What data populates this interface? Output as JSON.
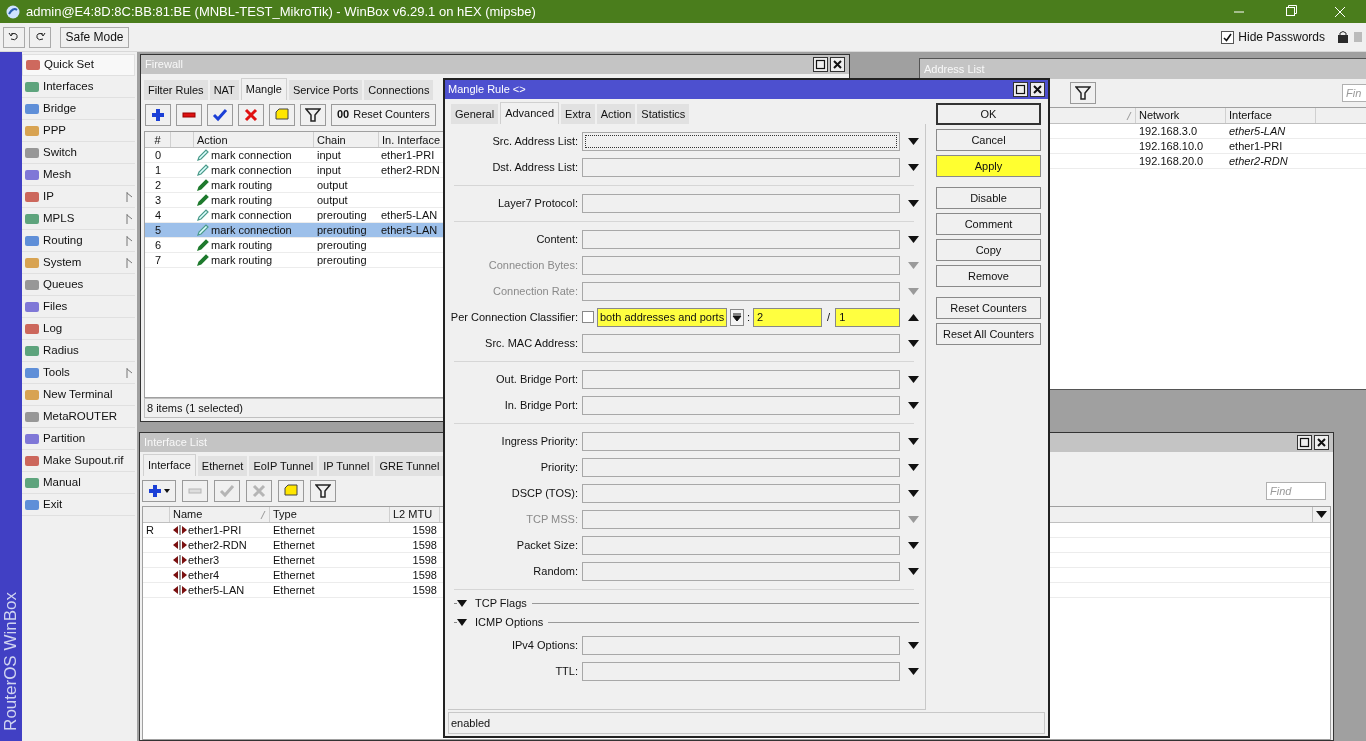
{
  "window": {
    "title": "admin@E4:8D:8C:BB:81:BE (MNBL-TEST_MikroTik) - WinBox v6.29.1 on hEX (mipsbe)"
  },
  "toolbar": {
    "safe_mode": "Safe Mode",
    "hide_passwords": {
      "label": "Hide Passwords",
      "checked": true
    }
  },
  "brand": "RouterOS WinBox",
  "sidebar": {
    "items": [
      {
        "label": "Quick Set",
        "submenu": false,
        "selected": true
      },
      {
        "label": "Interfaces",
        "submenu": false,
        "selected": false
      },
      {
        "label": "Bridge",
        "submenu": false,
        "selected": false
      },
      {
        "label": "PPP",
        "submenu": false,
        "selected": false
      },
      {
        "label": "Switch",
        "submenu": false,
        "selected": false
      },
      {
        "label": "Mesh",
        "submenu": false,
        "selected": false
      },
      {
        "label": "IP",
        "submenu": true,
        "selected": false
      },
      {
        "label": "MPLS",
        "submenu": true,
        "selected": false
      },
      {
        "label": "Routing",
        "submenu": true,
        "selected": false
      },
      {
        "label": "System",
        "submenu": true,
        "selected": false
      },
      {
        "label": "Queues",
        "submenu": false,
        "selected": false
      },
      {
        "label": "Files",
        "submenu": false,
        "selected": false
      },
      {
        "label": "Log",
        "submenu": false,
        "selected": false
      },
      {
        "label": "Radius",
        "submenu": false,
        "selected": false
      },
      {
        "label": "Tools",
        "submenu": true,
        "selected": false
      },
      {
        "label": "New Terminal",
        "submenu": false,
        "selected": false
      },
      {
        "label": "MetaROUTER",
        "submenu": false,
        "selected": false
      },
      {
        "label": "Partition",
        "submenu": false,
        "selected": false
      },
      {
        "label": "Make Supout.rif",
        "submenu": false,
        "selected": false
      },
      {
        "label": "Manual",
        "submenu": false,
        "selected": false
      },
      {
        "label": "Exit",
        "submenu": false,
        "selected": false
      }
    ]
  },
  "firewall": {
    "title": "Firewall",
    "tabs": [
      {
        "label": "Filter Rules",
        "selected": false
      },
      {
        "label": "NAT",
        "selected": false
      },
      {
        "label": "Mangle",
        "selected": true
      },
      {
        "label": "Service Ports",
        "selected": false
      },
      {
        "label": "Connections",
        "selected": false
      }
    ],
    "toolbar": [
      {
        "kind": "add",
        "disabled": false
      },
      {
        "kind": "remove",
        "disabled": false
      },
      {
        "kind": "enable",
        "disabled": false
      },
      {
        "kind": "disable",
        "disabled": false
      },
      {
        "kind": "comment",
        "disabled": false
      },
      {
        "kind": "filter",
        "disabled": false
      }
    ],
    "reset_button": {
      "prefix": "00",
      "label": "Reset Counters"
    },
    "columns": [
      "#",
      "Action",
      "Chain",
      "In. Interface"
    ],
    "rows": [
      {
        "num": "0",
        "kind": "connection",
        "action": "mark connection",
        "chain": "input",
        "in_interface": "ether1-PRI",
        "selected": false
      },
      {
        "num": "1",
        "kind": "connection",
        "action": "mark connection",
        "chain": "input",
        "in_interface": "ether2-RDN",
        "selected": false
      },
      {
        "num": "2",
        "kind": "routing",
        "action": "mark routing",
        "chain": "output",
        "selected": false
      },
      {
        "num": "3",
        "kind": "routing",
        "action": "mark routing",
        "chain": "output",
        "selected": false
      },
      {
        "num": "4",
        "kind": "connection",
        "action": "mark connection",
        "chain": "prerouting",
        "in_interface": "ether5-LAN",
        "selected": false
      },
      {
        "num": "5",
        "kind": "connection",
        "action": "mark connection",
        "chain": "prerouting",
        "in_interface": "ether5-LAN",
        "selected": true
      },
      {
        "num": "6",
        "kind": "routing",
        "action": "mark routing",
        "chain": "prerouting",
        "selected": false
      },
      {
        "num": "7",
        "kind": "routing",
        "action": "mark routing",
        "chain": "prerouting",
        "selected": false
      }
    ],
    "status": "8 items (1 selected)"
  },
  "address_list": {
    "title": "Address List",
    "find_placeholder": "Fin",
    "columns": [
      {
        "sorted": true
      },
      {
        "label": "Network",
        "sorted": false
      },
      {
        "label": "Interface",
        "sorted": false
      }
    ],
    "rows": [
      {
        "network": "192.168.3.0",
        "interface": "ether5-LAN",
        "dynamic": true
      },
      {
        "network": "192.168.10.0",
        "interface": "ether1-PRI",
        "dynamic": false
      },
      {
        "network": "192.168.20.0",
        "interface": "ether2-RDN",
        "dynamic": true
      }
    ]
  },
  "interface_list": {
    "title": "Interface List",
    "find_placeholder": "Find",
    "tabs": [
      {
        "label": "Interface",
        "selected": true
      },
      {
        "label": "Ethernet",
        "selected": false
      },
      {
        "label": "EoIP Tunnel",
        "selected": false
      },
      {
        "label": "IP Tunnel",
        "selected": false
      },
      {
        "label": "GRE Tunnel",
        "selected": false
      }
    ],
    "toolbar": [
      {
        "kind": "add-menu",
        "disabled": false
      },
      {
        "kind": "remove",
        "disabled": true
      },
      {
        "kind": "enable",
        "disabled": true
      },
      {
        "kind": "disable",
        "disabled": true
      },
      {
        "kind": "comment",
        "disabled": false
      },
      {
        "kind": "filter",
        "disabled": false
      }
    ],
    "columns": [
      {
        "label": "Name",
        "sorted": true
      },
      {
        "label": "Type",
        "sorted": false
      },
      {
        "label": "L2 MTU",
        "sorted": false
      }
    ],
    "rows": [
      {
        "flag": "R",
        "name": "ether1-PRI",
        "type": "Ethernet",
        "l2mtu": "1598"
      },
      {
        "name": "ether2-RDN",
        "type": "Ethernet",
        "l2mtu": "1598"
      },
      {
        "name": "ether3",
        "type": "Ethernet",
        "l2mtu": "1598"
      },
      {
        "name": "ether4",
        "type": "Ethernet",
        "l2mtu": "1598"
      },
      {
        "name": "ether5-LAN",
        "type": "Ethernet",
        "l2mtu": "1598"
      }
    ]
  },
  "mangle_rule": {
    "title": "Mangle Rule <>",
    "tabs": [
      {
        "label": "General",
        "selected": false
      },
      {
        "label": "Advanced",
        "selected": true
      },
      {
        "label": "Extra",
        "selected": false
      },
      {
        "label": "Action",
        "selected": false
      },
      {
        "label": "Statistics",
        "selected": false
      }
    ],
    "form": [
      {
        "kind": "field",
        "label": "Src. Address List:",
        "disabled": false,
        "expanded": false,
        "focused": true
      },
      {
        "kind": "field",
        "label": "Dst. Address List:",
        "disabled": false,
        "expanded": false,
        "focused": false
      },
      {
        "kind": "separator"
      },
      {
        "kind": "field",
        "label": "Layer7 Protocol:",
        "disabled": false,
        "expanded": false,
        "focused": false
      },
      {
        "kind": "separator"
      },
      {
        "kind": "field",
        "label": "Content:",
        "disabled": false,
        "expanded": false,
        "focused": false
      },
      {
        "kind": "field",
        "label": "Connection Bytes:",
        "disabled": true,
        "expanded": false,
        "focused": false
      },
      {
        "kind": "field",
        "label": "Connection Rate:",
        "disabled": true,
        "expanded": false,
        "focused": false
      },
      {
        "kind": "pcc",
        "label": "Per Connection Classifier:",
        "checked": false,
        "value": "both addresses and ports",
        "separator_1": ":",
        "num_1": "2",
        "separator_2": "/",
        "num_2": "1",
        "highlighted": true,
        "expanded": true
      },
      {
        "kind": "field",
        "label": "Src. MAC Address:",
        "disabled": false,
        "expanded": false,
        "focused": false
      },
      {
        "kind": "separator"
      },
      {
        "kind": "field",
        "label": "Out. Bridge Port:",
        "disabled": false,
        "expanded": false,
        "focused": false
      },
      {
        "kind": "field",
        "label": "In. Bridge Port:",
        "disabled": false,
        "expanded": false,
        "focused": false
      },
      {
        "kind": "separator"
      },
      {
        "kind": "field",
        "label": "Ingress Priority:",
        "disabled": false,
        "expanded": false,
        "focused": false
      },
      {
        "kind": "field",
        "label": "Priority:",
        "disabled": false,
        "expanded": false,
        "focused": false
      },
      {
        "kind": "field",
        "label": "DSCP (TOS):",
        "disabled": false,
        "expanded": false,
        "focused": false
      },
      {
        "kind": "field",
        "label": "TCP MSS:",
        "disabled": true,
        "expanded": false,
        "focused": false
      },
      {
        "kind": "field",
        "label": "Packet Size:",
        "disabled": false,
        "expanded": false,
        "focused": false
      },
      {
        "kind": "field",
        "label": "Random:",
        "disabled": false,
        "expanded": false,
        "focused": false
      },
      {
        "kind": "separator"
      },
      {
        "kind": "section",
        "label": "TCP Flags",
        "expanded": false
      },
      {
        "kind": "section",
        "label": "ICMP Options",
        "expanded": false
      },
      {
        "kind": "field",
        "label": "IPv4 Options:",
        "disabled": false,
        "expanded": false,
        "focused": false
      },
      {
        "kind": "field",
        "label": "TTL:",
        "disabled": false,
        "expanded": false,
        "focused": false
      }
    ],
    "buttons": [
      [
        {
          "label": "OK",
          "default": true,
          "highlighted": false
        },
        {
          "label": "Cancel",
          "default": false,
          "highlighted": false
        },
        {
          "label": "Apply",
          "default": false,
          "highlighted": true
        }
      ],
      [
        {
          "label": "Disable",
          "default": false,
          "highlighted": false
        },
        {
          "label": "Comment",
          "default": false,
          "highlighted": false
        },
        {
          "label": "Copy",
          "default": false,
          "highlighted": false
        },
        {
          "label": "Remove",
          "default": false,
          "highlighted": false
        }
      ],
      [
        {
          "label": "Reset Counters",
          "default": false,
          "highlighted": false
        },
        {
          "label": "Reset All Counters",
          "default": false,
          "highlighted": false
        }
      ]
    ],
    "status": "enabled"
  }
}
